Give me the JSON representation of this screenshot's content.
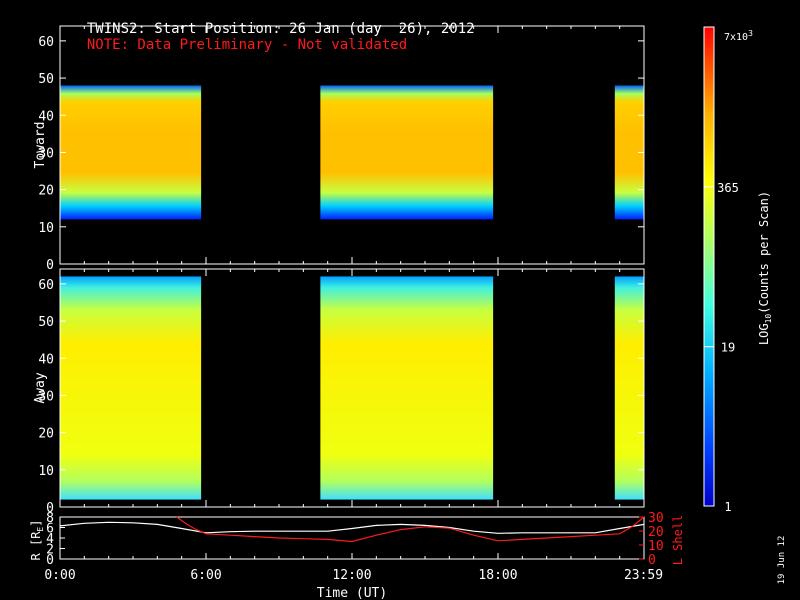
{
  "header": {
    "title": "TWINS2: Start Position: 26 Jan (day  26), 2012",
    "note": "NOTE: Data Preliminary - Not validated"
  },
  "stamp": "19 Jun 12",
  "colors": {
    "white": "#ffffff",
    "red": "#ff1a1a"
  },
  "chart_data": [
    {
      "type": "heatmap",
      "ylabel": "Toward",
      "ylim": [
        0,
        64
      ],
      "yticks": [
        0,
        10,
        20,
        30,
        40,
        50,
        60
      ],
      "xlim": [
        0,
        24
      ],
      "data_intervals": [
        [
          0,
          5.8
        ],
        [
          10.7,
          17.8
        ],
        [
          22.8,
          24
        ]
      ],
      "band_rows": [
        [
          12,
          48
        ]
      ],
      "grid": false
    },
    {
      "type": "heatmap",
      "ylabel": "Away",
      "ylim": [
        0,
        64
      ],
      "yticks": [
        0,
        10,
        20,
        30,
        40,
        50,
        60
      ],
      "xlim": [
        0,
        24
      ],
      "data_intervals": [
        [
          0,
          5.8
        ],
        [
          10.7,
          17.8
        ],
        [
          22.8,
          24
        ]
      ],
      "band_rows": [
        [
          2,
          62
        ]
      ],
      "grid": false
    },
    {
      "type": "line",
      "ylabel": "R [R",
      "ylabel_sub": "E",
      "ylabel_end": "]",
      "ylim": [
        0,
        8
      ],
      "yticks": [
        0,
        2,
        4,
        6,
        8
      ],
      "ylabel_right": "L Shell",
      "ylim_right": [
        0,
        30
      ],
      "yticks_right": [
        0,
        10,
        20,
        30
      ],
      "xlabel": "Time (UT)",
      "xticks": [
        0,
        6,
        12,
        18,
        23.98
      ],
      "xtick_labels": [
        "0:00",
        "6:00",
        "12:00",
        "18:00",
        "23:59"
      ],
      "series": [
        {
          "axis": "left",
          "color": "#ffffff",
          "x": [
            0,
            1,
            2,
            3,
            4,
            5,
            6,
            7,
            8,
            9,
            10,
            11,
            12,
            13,
            14,
            15,
            16,
            17,
            18,
            19,
            20,
            21,
            22,
            23,
            24
          ],
          "y": [
            6.3,
            6.8,
            7.0,
            6.9,
            6.6,
            5.8,
            5.0,
            5.2,
            5.3,
            5.3,
            5.3,
            5.3,
            5.8,
            6.4,
            6.6,
            6.4,
            6.0,
            5.3,
            4.9,
            5.0,
            5.0,
            5.0,
            5.0,
            5.8,
            6.6
          ]
        },
        {
          "axis": "right",
          "color": "#ff1a1a",
          "x": [
            4.8,
            5.2,
            5.6,
            6,
            7,
            8,
            9,
            10,
            11,
            12,
            13,
            14,
            15,
            16,
            17,
            18,
            19,
            20,
            21,
            22,
            23,
            23.5,
            24
          ],
          "y": [
            30,
            25,
            21,
            18,
            17,
            16,
            15,
            14.5,
            14,
            12.5,
            17,
            21,
            23,
            22,
            17,
            13,
            14,
            15,
            16,
            17,
            18,
            23,
            30
          ]
        }
      ]
    }
  ],
  "colorbar": {
    "label": "LOG",
    "label_sub": "10",
    "label_end": "(Counts per Scan)",
    "ticks": [
      "1",
      "19",
      "365"
    ],
    "tick_values": [
      1,
      19,
      365
    ],
    "max_label": "7x10",
    "max_exp": "3",
    "max_value": 7000
  }
}
